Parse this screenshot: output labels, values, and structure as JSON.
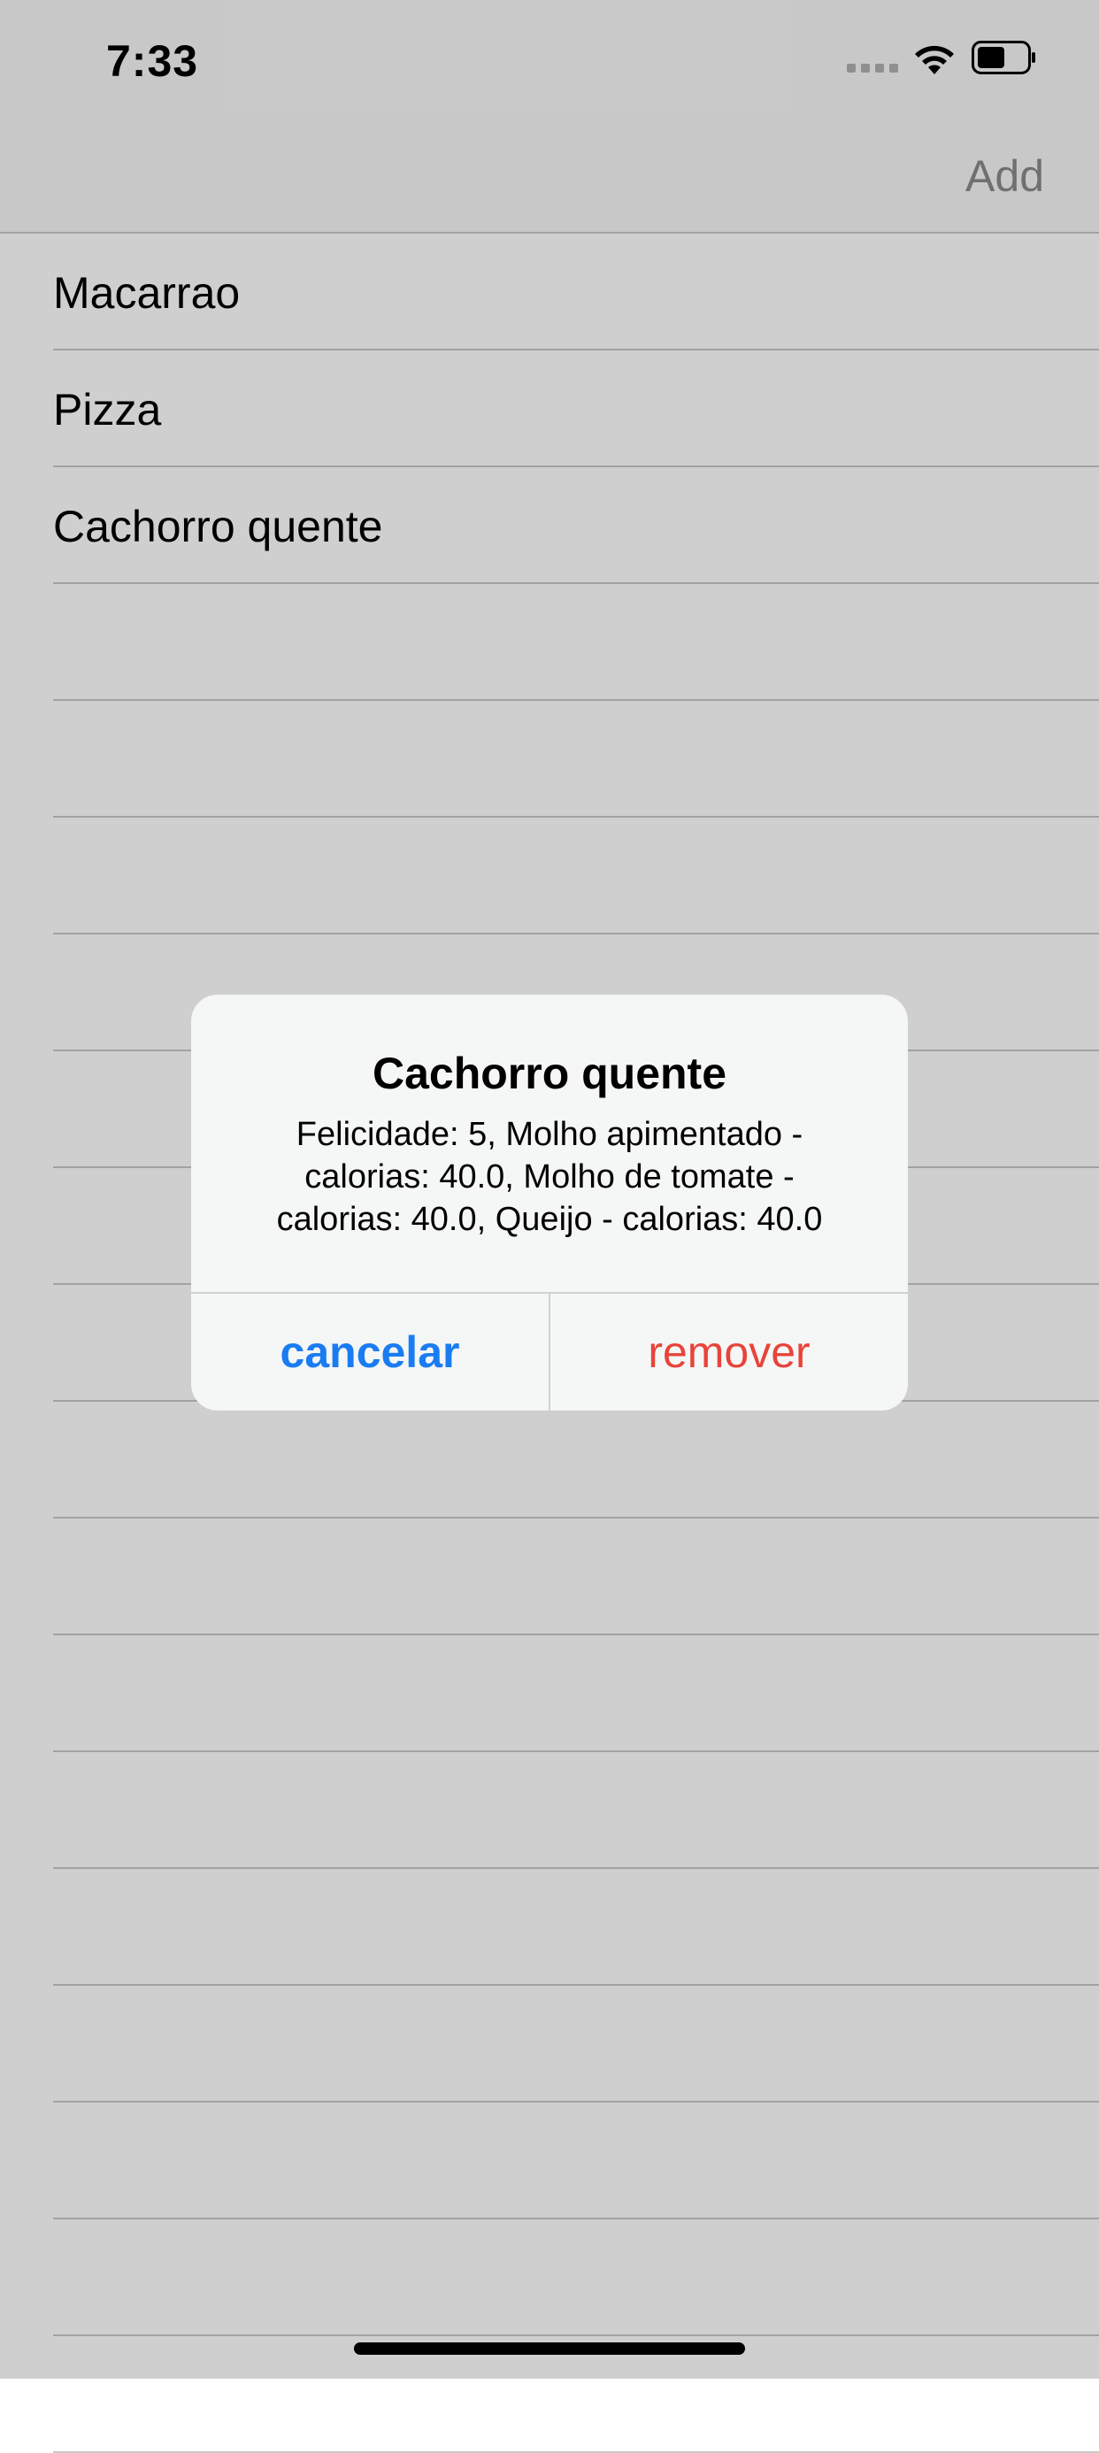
{
  "status_bar": {
    "time": "7:33",
    "icons": [
      "signal-icon",
      "wifi-icon",
      "battery-icon"
    ]
  },
  "nav": {
    "add_label": "Add"
  },
  "table": {
    "rows": [
      {
        "label": "Macarrao"
      },
      {
        "label": "Pizza"
      },
      {
        "label": "Cachorro quente"
      },
      {
        "label": ""
      },
      {
        "label": ""
      },
      {
        "label": ""
      },
      {
        "label": ""
      },
      {
        "label": ""
      },
      {
        "label": ""
      },
      {
        "label": ""
      },
      {
        "label": ""
      },
      {
        "label": ""
      },
      {
        "label": ""
      },
      {
        "label": ""
      },
      {
        "label": ""
      },
      {
        "label": ""
      },
      {
        "label": ""
      },
      {
        "label": ""
      },
      {
        "label": ""
      }
    ]
  },
  "alert": {
    "title": "Cachorro quente",
    "message_lines": [
      "Felicidade: 5, Molho apimentado -",
      "calorias: 40.0, Molho de tomate -",
      "calorias: 40.0, Queijo - calorias: 40.0"
    ],
    "cancel_label": "cancelar",
    "remove_label": "remover"
  },
  "colors": {
    "cancel": "#1a7cf2",
    "remove": "#e8443a",
    "nav_add": "#8a8a8a"
  }
}
